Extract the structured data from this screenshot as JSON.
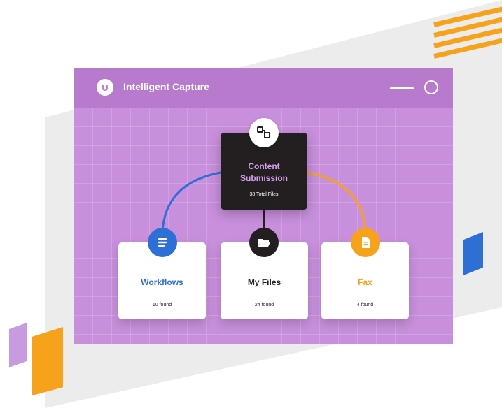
{
  "app": {
    "title": "Intelligent Capture",
    "logo_letter": "U"
  },
  "center": {
    "title_line1": "Content",
    "title_line2": "Submission",
    "subtitle": "38 Total Files",
    "icon": "blocks-icon"
  },
  "cards": [
    {
      "title": "Workflows",
      "count": "10 found",
      "icon": "list-icon",
      "color": "#2e6fd6"
    },
    {
      "title": "My Files",
      "count": "24 found",
      "icon": "folder-icon",
      "color": "#231f20"
    },
    {
      "title": "Fax",
      "count": "4 found",
      "icon": "document-icon",
      "color": "#f7a21b"
    }
  ],
  "colors": {
    "accent_purple": "#c88fdc",
    "header_purple": "#b87acc",
    "blue": "#2e6fd6",
    "orange": "#f7a21b",
    "dark": "#231f20"
  }
}
